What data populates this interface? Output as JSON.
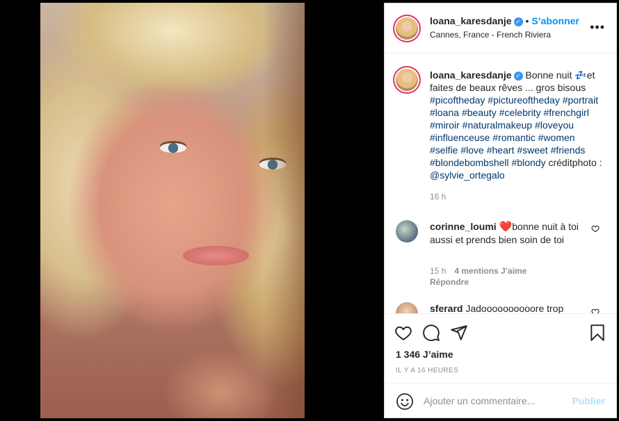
{
  "post": {
    "image_alt": "selfie photo",
    "username": "loana_karesdanje",
    "verified_mark": "✓",
    "separator": "•",
    "follow_label": "S’abonner",
    "location": "Cannes, France - French Riviera",
    "more_label": "•••"
  },
  "caption": {
    "username": "loana_karesdanje",
    "text_before": "Bonne nuit ",
    "sleep_emoji": "💤",
    "text_after": "et faites de beaux rêves ... gros bisous",
    "hashtags": [
      "#picoftheday",
      "#pictureoftheday",
      "#portrait",
      "#loana",
      "#beauty",
      "#celebrity",
      "#frenchgirl",
      "#miroir",
      "#naturalmakeup",
      "#loveyou",
      "#influenceuse",
      "#romantic",
      "#women",
      "#selfie",
      "#love",
      "#heart",
      "#sweet",
      "#friends",
      "#blondebombshell",
      "#blondy"
    ],
    "credit_label": "créditphoto : ",
    "credit_handle": "@sylvie_ortegalo",
    "time": "16 h"
  },
  "comments": [
    {
      "username": "corinne_loumi",
      "emoji": "❤️",
      "text": "bonne nuit à toi aussi et prends bien soin de toi",
      "time": "15 h",
      "likes": "4 mentions J’aime",
      "reply_label": "Répondre"
    },
    {
      "username": "sferard",
      "text": "Jadoooooooooore trop"
    }
  ],
  "actions": {
    "like_icon": "heart-icon",
    "comment_icon": "comment-icon",
    "share_icon": "share-icon",
    "save_icon": "bookmark-icon",
    "likes_count": "1 346 J’aime",
    "date": "IL Y A 16 HEURES"
  },
  "add_comment": {
    "placeholder": "Ajouter un commentaire...",
    "publish_label": "Publier"
  },
  "colors": {
    "accent": "#0095f6",
    "hashtag": "#00376b",
    "muted": "#8e8e8e",
    "verified": "#3897f0"
  }
}
